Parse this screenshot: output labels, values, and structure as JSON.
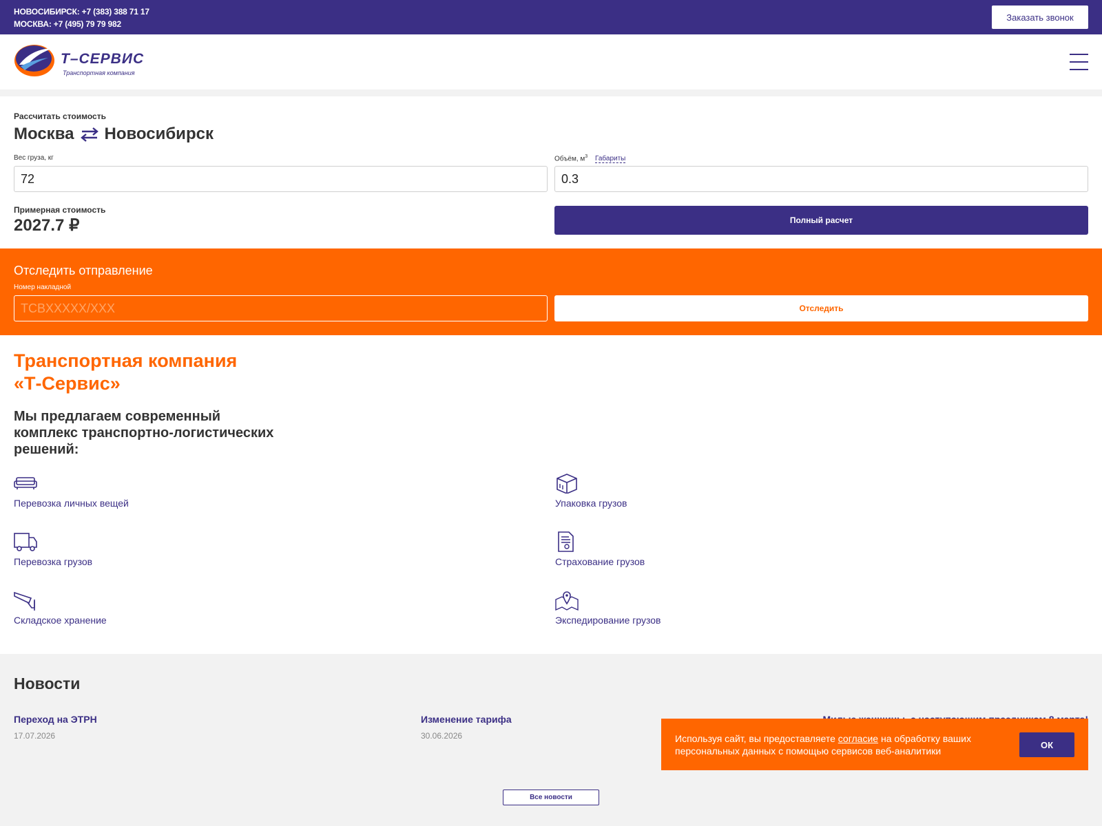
{
  "topbar": {
    "phone_nsk": "НОВОСИБИРСК: +7 (383) 388 71 17",
    "phone_msk": "МОСКВА: +7 (495) 79 79 982",
    "callback_label": "Заказать звонок"
  },
  "logo": {
    "brand": "Т–СЕРВИС",
    "subtitle": "Транспортная компания"
  },
  "calculator": {
    "caption": "Рассчитать стоимость",
    "from": "Москва",
    "to": "Новосибирск",
    "weight_label": "Вес груза, кг",
    "weight_value": "72",
    "volume_label": "Объём, м",
    "volume_unit_sup": "3",
    "dims_link": "Габариты",
    "volume_value": "0.3",
    "approx_label": "Примерная стоимость",
    "approx_value": "2027.7 ₽",
    "full_calc_label": "Полный расчет"
  },
  "tracking": {
    "title": "Отследить отправление",
    "field_label": "Номер накладной",
    "placeholder": "ТСВXXXXX/XXX",
    "button_label": "Отследить"
  },
  "about": {
    "title_line1": "Транспортная компания",
    "title_line2": "«Т-Сервис»",
    "subtitle": "Мы предлагаем современный комплекс транспортно-логистических решений:",
    "services": [
      {
        "label": "Перевозка личных вещей",
        "icon": "sofa-icon"
      },
      {
        "label": "Упаковка грузов",
        "icon": "box-icon"
      },
      {
        "label": "Перевозка грузов",
        "icon": "truck-icon"
      },
      {
        "label": "Страхование грузов",
        "icon": "document-icon"
      },
      {
        "label": "Складское хранение",
        "icon": "camera-icon"
      },
      {
        "label": "Экспедирование грузов",
        "icon": "map-pin-icon"
      }
    ]
  },
  "news": {
    "title": "Новости",
    "items": [
      {
        "title": "Переход на ЭТРН",
        "date": "17.07.2026"
      },
      {
        "title": "Изменение тарифа",
        "date": "30.06.2026"
      },
      {
        "title": "Милые женщины, с наступающим праздником 8 марта!",
        "date": ""
      }
    ],
    "all_label": "Все новости"
  },
  "cookie": {
    "text_before": "Используя сайт, вы предоставляете ",
    "link": "согласие",
    "text_after": " на обработку ваших персональных данных с помощью сервисов веб-аналитики",
    "ok_label": "ОК"
  },
  "colors": {
    "brand_purple": "#3b2f85",
    "brand_orange": "#ff6600",
    "background_gray": "#f2f2f2"
  }
}
